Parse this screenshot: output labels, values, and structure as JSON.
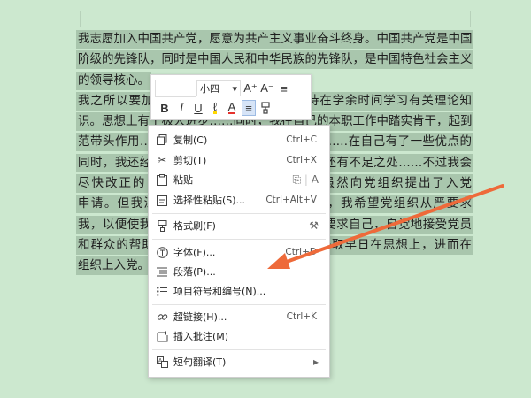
{
  "document": {
    "lines": [
      "我志愿加入中国共产党，愿意为共产主义事业奋斗终身。中国共产党是中国工人",
      "阶级的先锋队，同时是中国人民和中华民族的先锋队，是中国特色社会主义事业",
      "的领导核心。",
      "我之所以要加入中国共产党，是因为我坚持在学余时间学习有关理论知",
      "识。思想上有了极大进步……同时，我在自己的本职工作中踏实肯干，起到了模",
      "范带头作用……我在……工作中取得……心得……在自己有了一些优点的",
      "同时，我还经常……也清楚地认识到自己还有还有不足之处……不过我会",
      "尽快改正的，同时……更完善。总之，我虽然向党组织提出了入党",
      "申请。但我深深……符合党员的标准，因此，我希望党组织从严要求",
      "我，以便使我更……严格按照党员的标准严格要求自己，自觉地接受党员",
      "和群众的帮助与……按照党员的标准……，争取早日在思想上，进而在",
      "组织上入党。"
    ]
  },
  "toolbar": {
    "font_name": "",
    "font_size": "小四",
    "increase_font": "A⁺",
    "decrease_font": "A⁻",
    "line_spacing": "≡",
    "bold": "B",
    "italic": "I",
    "underline": "U",
    "highlight": "ℓ",
    "font_color": "A",
    "align": "≡",
    "format_painter": "⚲"
  },
  "menu": {
    "items": [
      {
        "label": "复制(C)",
        "shortcut": "Ctrl+C",
        "icon": "copy-icon"
      },
      {
        "label": "剪切(T)",
        "shortcut": "Ctrl+X",
        "icon": "scissors-icon"
      },
      {
        "label": "粘贴",
        "shortcut": "",
        "icon": "paste-icon"
      },
      {
        "label": "选择性粘贴(S)...",
        "shortcut": "Ctrl+Alt+V",
        "icon": "paste-special-icon"
      },
      {
        "label": "格式刷(F)",
        "shortcut": "",
        "icon": "format-painter-icon"
      },
      {
        "label": "字体(F)...",
        "shortcut": "Ctrl+D",
        "icon": "font-icon"
      },
      {
        "label": "段落(P)...",
        "shortcut": "",
        "icon": "paragraph-icon"
      },
      {
        "label": "项目符号和编号(N)...",
        "shortcut": "",
        "icon": "bullets-icon"
      },
      {
        "label": "超链接(H)...",
        "shortcut": "Ctrl+K",
        "icon": "hyperlink-icon"
      },
      {
        "label": "插入批注(M)",
        "shortcut": "",
        "icon": "comment-icon"
      },
      {
        "label": "短句翻译(T)",
        "shortcut": "",
        "icon": "translate-icon"
      }
    ]
  },
  "colors": {
    "background": "#cce8cf",
    "highlight": "#a9c6ad",
    "arrow": "#ee6a3a"
  }
}
